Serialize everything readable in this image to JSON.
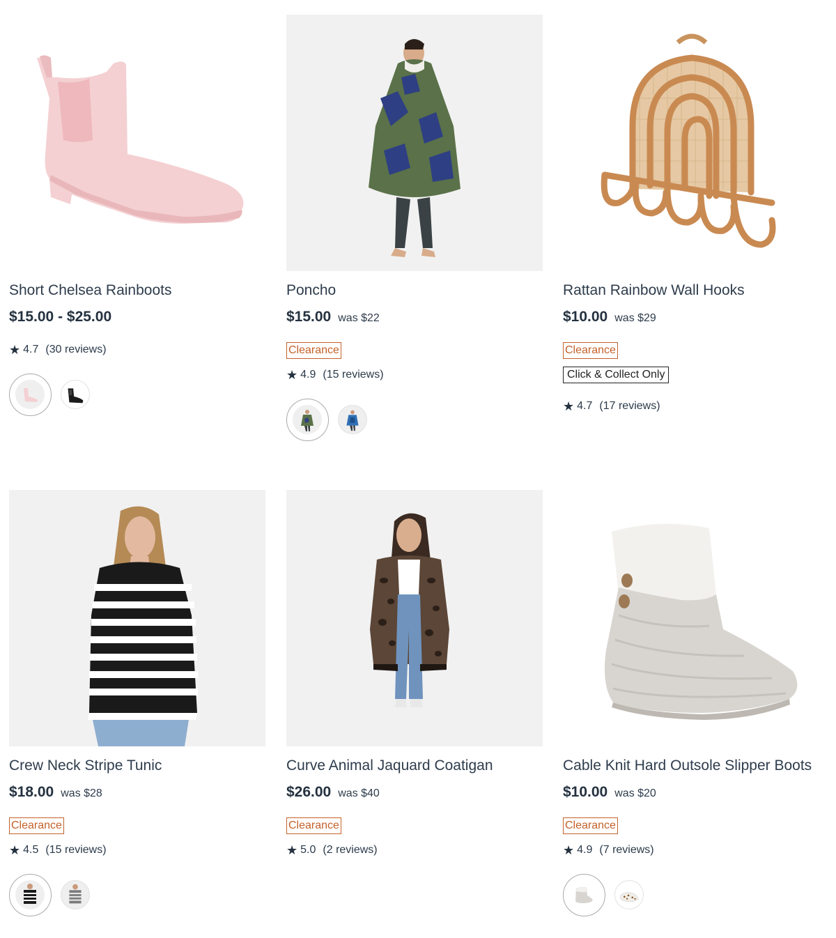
{
  "products": [
    {
      "title": "Short Chelsea Rainboots",
      "price": "$15.00 - $25.00",
      "was": "",
      "badges": [],
      "rating": "4.7",
      "reviews": "(30 reviews)",
      "image": "pink-chelsea-rainboot",
      "swatches": [
        "pink-boot",
        "black-boot"
      ]
    },
    {
      "title": "Poncho",
      "price": "$15.00",
      "was": "was $22",
      "badges": [
        "Clearance"
      ],
      "rating": "4.9",
      "reviews": "(15 reviews)",
      "image": "camo-poncho-kid",
      "swatches": [
        "camo-poncho",
        "blue-poncho"
      ]
    },
    {
      "title": "Rattan Rainbow Wall Hooks",
      "price": "$10.00",
      "was": "was $29",
      "badges": [
        "Clearance",
        "Click & Collect Only"
      ],
      "rating": "4.7",
      "reviews": "(17 reviews)",
      "image": "rattan-rainbow-hooks",
      "swatches": []
    },
    {
      "title": "Crew Neck Stripe Tunic",
      "price": "$18.00",
      "was": "was $28",
      "badges": [
        "Clearance"
      ],
      "rating": "4.5",
      "reviews": "(15 reviews)",
      "image": "striped-tunic-model",
      "swatches": [
        "black-stripe",
        "grey-stripe"
      ]
    },
    {
      "title": "Curve Animal Jaquard Coatigan",
      "price": "$26.00",
      "was": "was $40",
      "badges": [
        "Clearance"
      ],
      "rating": "5.0",
      "reviews": "(2 reviews)",
      "image": "animal-coatigan-model",
      "swatches": []
    },
    {
      "title": "Cable Knit Hard Outsole Slipper Boots",
      "price": "$10.00",
      "was": "was $20",
      "badges": [
        "Clearance"
      ],
      "rating": "4.9",
      "reviews": "(7 reviews)",
      "image": "knit-slipper-boot",
      "swatches": [
        "grey-slipper",
        "leopard-slipper"
      ]
    }
  ],
  "colors": {
    "title": "#2e3c4c",
    "price": "#24313f",
    "clearance": "#c4612a",
    "click_collect": "#222222",
    "image_bg": "#f1f1f1"
  },
  "icons": {
    "rating": "star-icon"
  }
}
